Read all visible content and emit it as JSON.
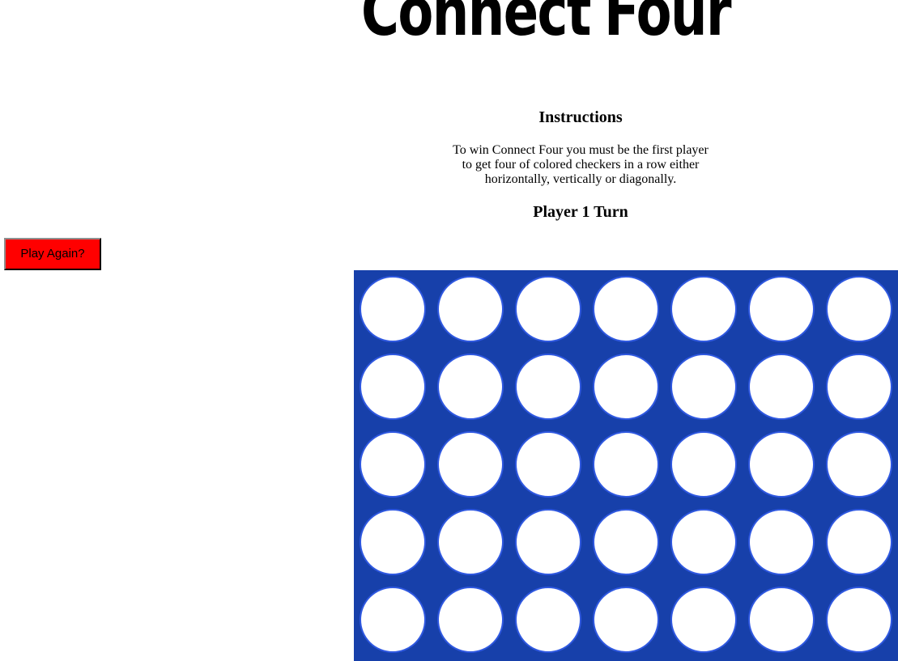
{
  "title": {
    "word1": "Connect",
    "word2": "Four"
  },
  "instructions": {
    "heading": "Instructions",
    "text": "To win Connect Four you must be the first player to get four of colored checkers in a row either horizontally, vertically or diagonally."
  },
  "turn": {
    "label": "Player 1 Turn"
  },
  "controls": {
    "play_again_label": "Play Again?",
    "play_again_color": "#ff0000"
  },
  "board": {
    "board_color": "#1740aa",
    "slot_color": "#ffffff",
    "slot_border_color": "#2f58e0",
    "rows": 5,
    "columns": 7,
    "cells": [
      [
        "empty",
        "empty",
        "empty",
        "empty",
        "empty",
        "empty",
        "empty"
      ],
      [
        "empty",
        "empty",
        "empty",
        "empty",
        "empty",
        "empty",
        "empty"
      ],
      [
        "empty",
        "empty",
        "empty",
        "empty",
        "empty",
        "empty",
        "empty"
      ],
      [
        "empty",
        "empty",
        "empty",
        "empty",
        "empty",
        "empty",
        "empty"
      ],
      [
        "empty",
        "empty",
        "empty",
        "empty",
        "empty",
        "empty",
        "empty"
      ]
    ]
  }
}
